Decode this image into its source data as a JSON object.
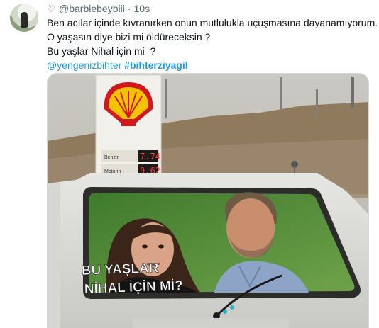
{
  "tweet": {
    "author_handle": "@barbiebeybiii",
    "separator": "·",
    "time": "10s",
    "text_lines": [
      "Ben acılar içinde kıvranırken onun mutlulukla uçuşmasına dayanamıyorum.",
      "O yaşasın diye bizi mi öldüreceksin ?",
      "Bu yaşlar Nihal için mi  ?"
    ],
    "mention": "@yengenizbihter",
    "hashtag": "#bihterziyagil"
  },
  "media": {
    "station_sign_row1": "Benzin",
    "station_sign_row2": "Motorin",
    "price1": "7.74",
    "price2": "9.62",
    "overlay_line1": "BU YAŞLAR",
    "overlay_line2": "NİHAL İÇİN Mİ?"
  },
  "colors": {
    "link": "#1d9bf0",
    "text": "#0f1419",
    "secondary": "#536471",
    "shell_yellow": "#f4c300",
    "shell_red": "#d2181b"
  },
  "icons": {
    "like": "heart-outline-icon"
  }
}
